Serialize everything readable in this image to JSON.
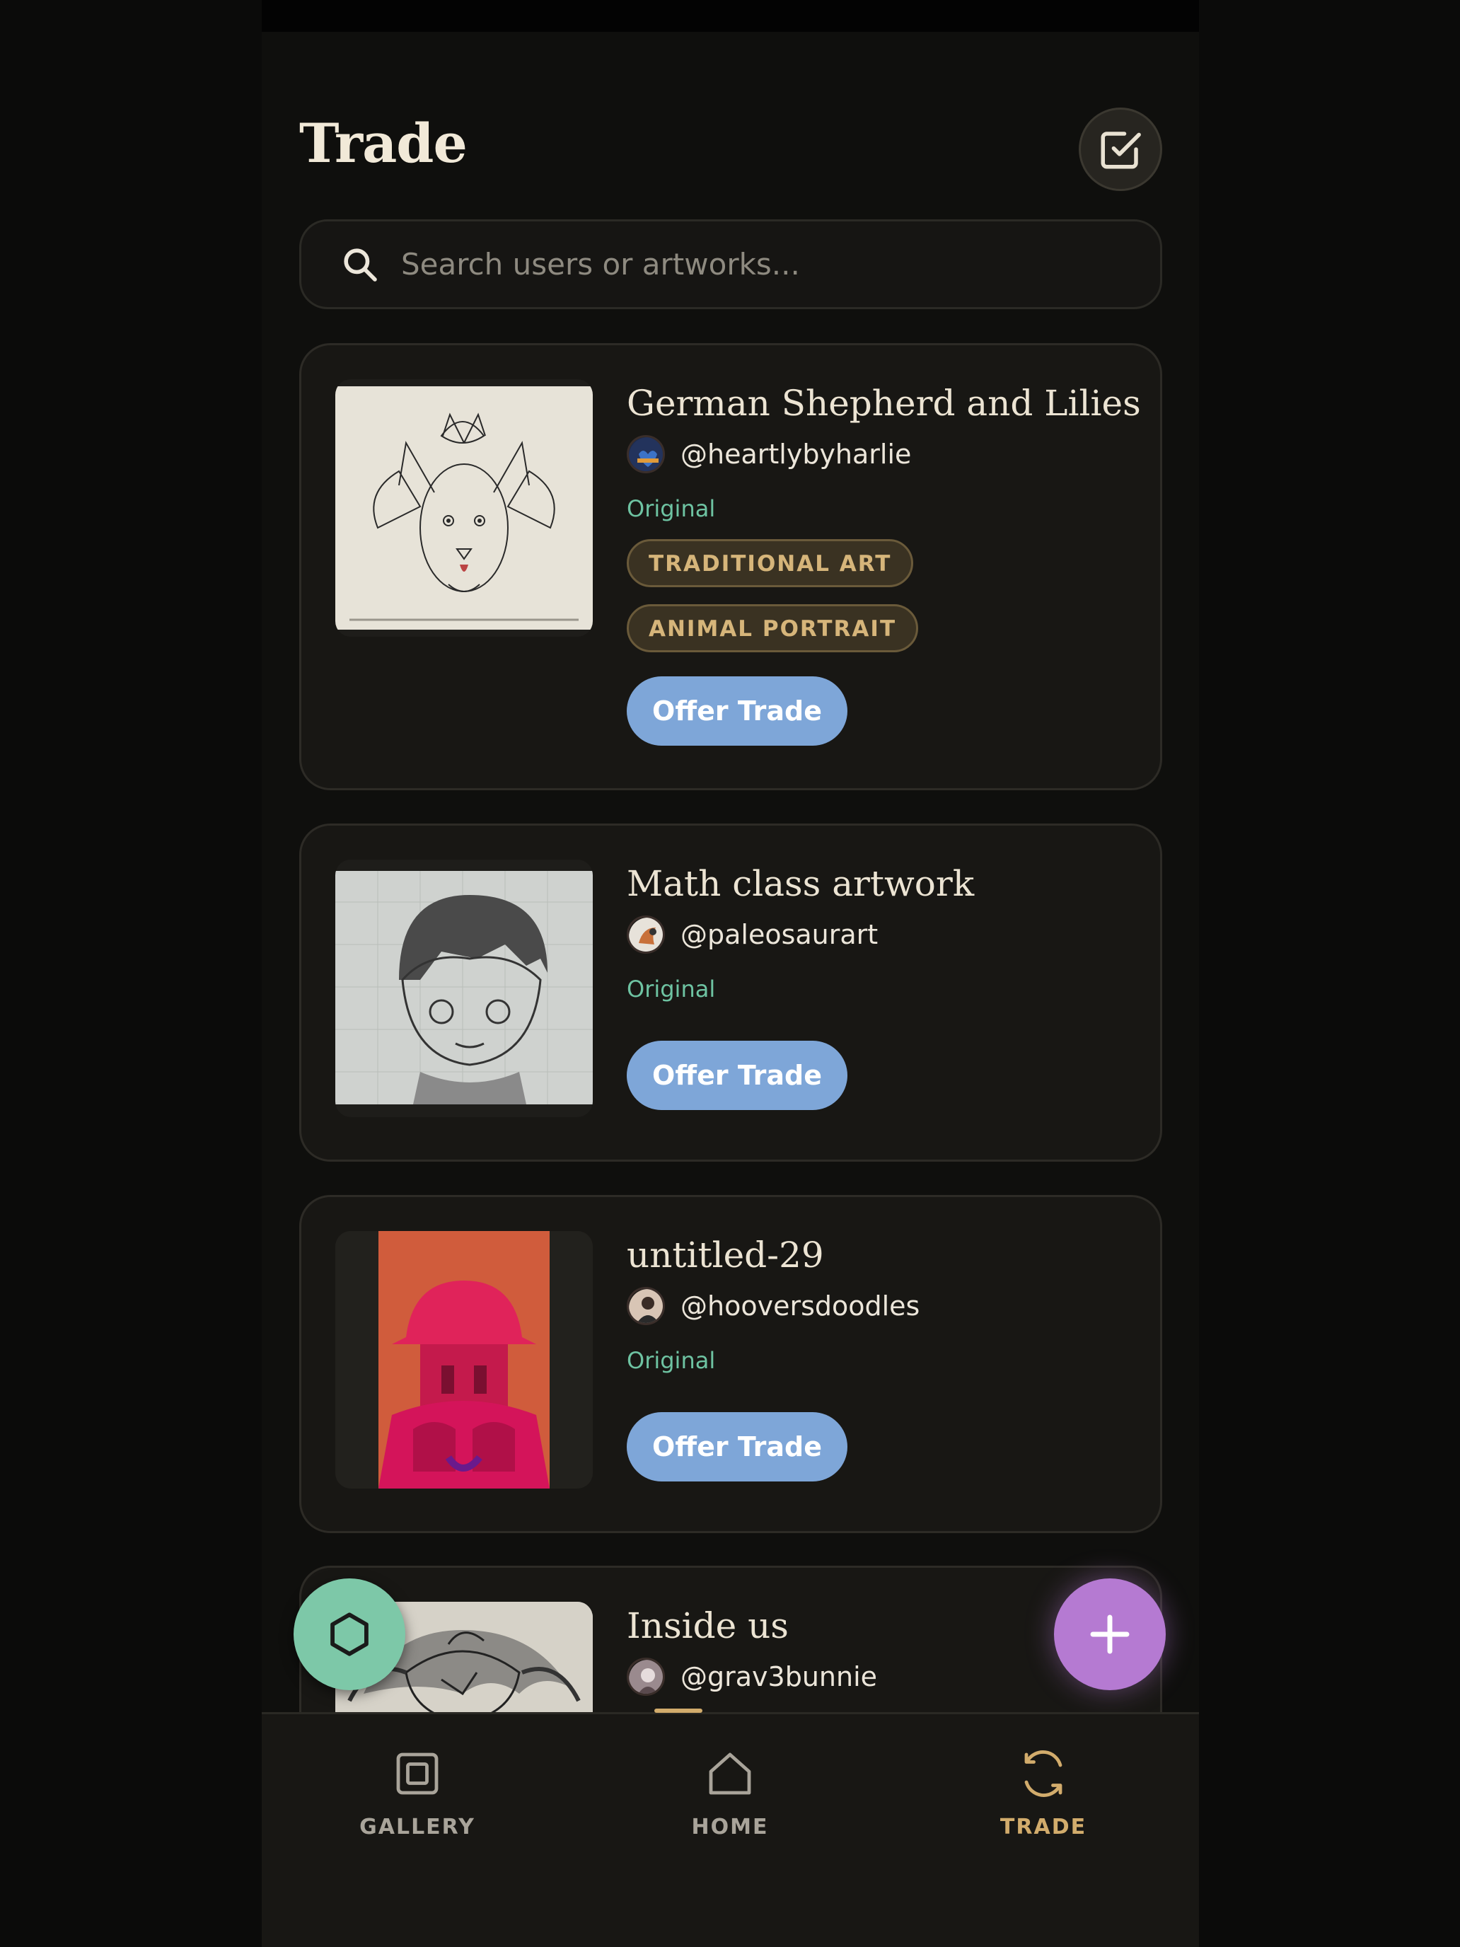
{
  "header": {
    "title": "Trade"
  },
  "search": {
    "placeholder": "Search users or artworks..."
  },
  "listings": [
    {
      "title": "German Shepherd and Lilies",
      "artist": "@heartlybyharlie",
      "condition": "Original",
      "tags": [
        "TRADITIONAL ART",
        "ANIMAL PORTRAIT"
      ],
      "action": "Offer Trade"
    },
    {
      "title": "Math class artwork",
      "artist": "@paleosaurart",
      "condition": "Original",
      "tags": [],
      "action": "Offer Trade"
    },
    {
      "title": "untitled-29",
      "artist": "@hooversdoodles",
      "condition": "Original",
      "tags": [],
      "action": "Offer Trade"
    },
    {
      "title": "Inside us",
      "artist": "@grav3bunnie"
    }
  ],
  "nav": {
    "items": [
      {
        "label": "GALLERY",
        "icon": "gallery-icon"
      },
      {
        "label": "HOME",
        "icon": "home-icon"
      },
      {
        "label": "TRADE",
        "icon": "trade-icon",
        "active": true
      }
    ]
  },
  "fabs": {
    "left_icon": "hexagon-icon",
    "right_icon": "plus-icon"
  },
  "colors": {
    "background": "#0f0f0d",
    "card": "#181714",
    "accent_gold": "#d2ac6c",
    "offer_button": "#7ea6d8",
    "original_text": "#6ec3a2",
    "fab_green": "#7dc8a8",
    "fab_purple": "#b57ad2"
  }
}
